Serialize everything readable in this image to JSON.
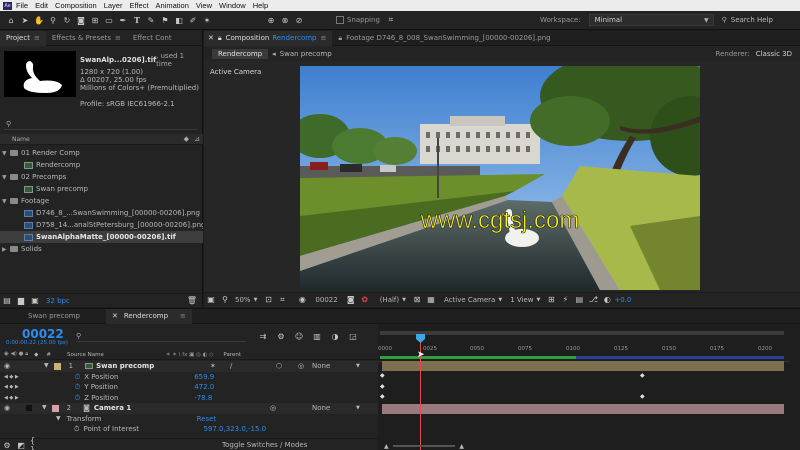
{
  "menubar": {
    "app_icon": "Ae",
    "items": [
      "File",
      "Edit",
      "Composition",
      "Layer",
      "Effect",
      "Animation",
      "View",
      "Window",
      "Help"
    ]
  },
  "toolbar": {
    "snapping_label": "Snapping",
    "workspace_label": "Workspace:",
    "workspace_value": "Minimal",
    "search_placeholder": "Search Help"
  },
  "project": {
    "tabs": [
      "Project",
      "Effects & Presets",
      "Effect Cont"
    ],
    "preview_name": "SwanAlp...0206].tif",
    "preview_used": ", used 1 time",
    "preview_info": [
      "1280 x 720 (1.00)",
      "Δ 00207, 25.00 fps",
      "Millions of Colors+ (Premultiplied)"
    ],
    "profile": "Profile: sRGB IEC61966-2.1",
    "column_name": "Name",
    "items": [
      {
        "label": "01 Render Comp",
        "type": "folder"
      },
      {
        "label": "Rendercomp",
        "type": "comp"
      },
      {
        "label": "02 Precomps",
        "type": "folder"
      },
      {
        "label": "Swan precomp",
        "type": "comp"
      },
      {
        "label": "Footage",
        "type": "folder"
      },
      {
        "label": "D746_8_...SwanSwimming_[00000-00206].png",
        "type": "file"
      },
      {
        "label": "D758_14...analStPetersburg_[00000-00206].png",
        "type": "file"
      },
      {
        "label": "SwanAlphaMatte_[00000-00206].tif",
        "type": "file"
      },
      {
        "label": "Solids",
        "type": "folder"
      }
    ],
    "bpc": "32 bpc"
  },
  "comp": {
    "tab_label": "Composition",
    "tab_comp": "Rendercomp",
    "footage_tab": "Footage D746_8_008_SwanSwimming_[00000-00206].png",
    "subtabs": [
      "Rendercomp",
      "Swan precomp"
    ],
    "renderer_label": "Renderer:",
    "renderer_value": "Classic 3D",
    "active_camera": "Active Camera",
    "watermark": "www.cgtsj.com",
    "footer": {
      "zoom": "50%",
      "timecode": "00022",
      "resolution": "(Half)",
      "view": "Active Camera",
      "views": "1 View",
      "exposure": "+0.0"
    }
  },
  "timeline": {
    "tabs": [
      "Swan precomp",
      "Rendercomp"
    ],
    "timecode": "00022",
    "timecode_sub": "0:00:00:22 (25.00 fps)",
    "col_source": "Source Name",
    "col_parent": "Parent",
    "ruler": [
      "0000",
      "0025",
      "0050",
      "0075",
      "0100",
      "0125",
      "0150",
      "0175",
      "0200"
    ],
    "playhead_frame": 22,
    "total_frames": 206,
    "layers": [
      {
        "num": "1",
        "name": "Swan precomp",
        "parent": "None",
        "color": "#c9b27a"
      },
      {
        "num": "2",
        "name": "Camera 1",
        "parent": "None",
        "color": "#d7a1a8"
      }
    ],
    "props": [
      {
        "name": "X Position",
        "value": "659.9"
      },
      {
        "name": "Y Position",
        "value": "472.0"
      },
      {
        "name": "Z Position",
        "value": "-78.8"
      }
    ],
    "transform_label": "Transform",
    "reset_label": "Reset",
    "poi_label": "Point of Interest",
    "poi_value": "597.0,323.0,-15.0",
    "toggle_label": "Toggle Switches / Modes"
  }
}
